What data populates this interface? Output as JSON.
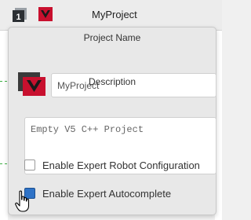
{
  "header": {
    "project_title": "MyProject",
    "slot_icon": "slot-number-1-icon",
    "brand_icon": "vex-logo-icon",
    "brand_color": "#c8102e"
  },
  "popup": {
    "project_name_label": "Project Name",
    "project_name_value": "MyProject",
    "description_label": "Description",
    "description_value": "Empty V5 C++ Project",
    "project_icon": "vex-logo-icon",
    "options": [
      {
        "label": "Enable Expert Robot Configuration",
        "checked": false
      },
      {
        "label": "Enable Expert Autocomplete",
        "checked": true
      }
    ]
  },
  "cursor": "hand-pointer-icon",
  "colors": {
    "accent": "#2f73c7",
    "brand": "#c8102e",
    "connector": "#3cb043"
  }
}
